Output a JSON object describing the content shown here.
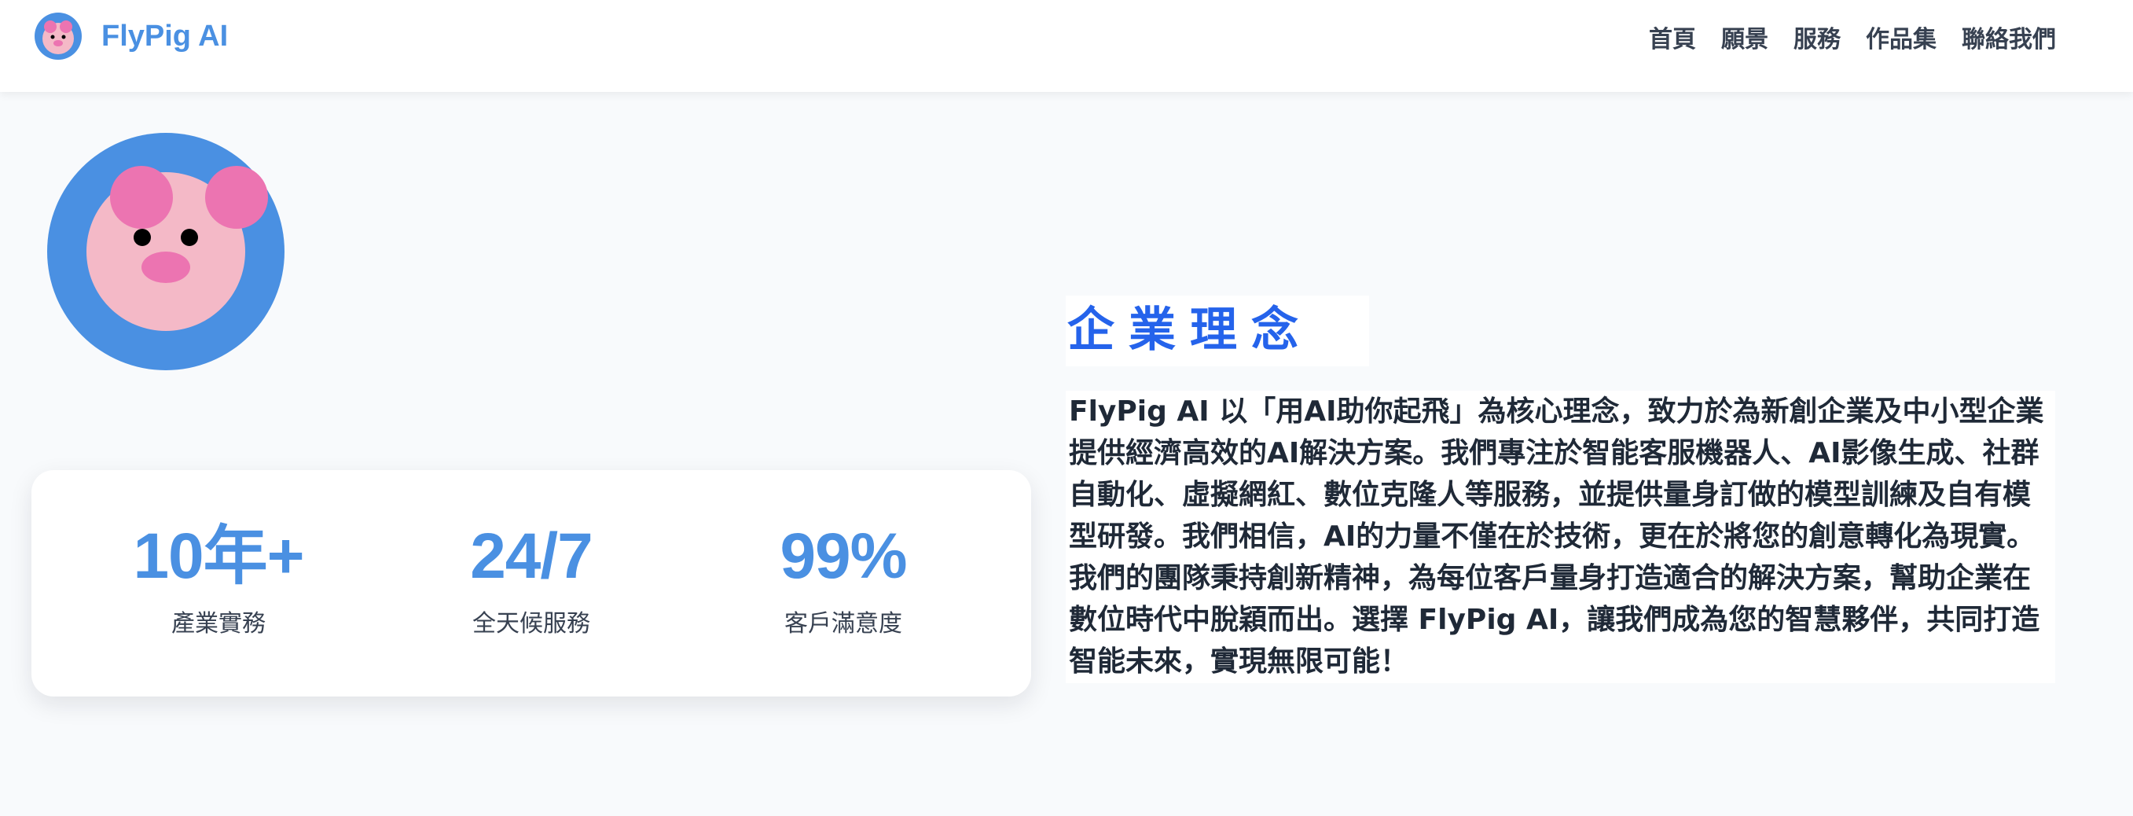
{
  "header": {
    "brand_name": "FlyPig AI",
    "nav": [
      {
        "label": "首頁"
      },
      {
        "label": "願景"
      },
      {
        "label": "服務"
      },
      {
        "label": "作品集"
      },
      {
        "label": "聯絡我們"
      }
    ]
  },
  "stats": [
    {
      "value": "10年+",
      "label": "產業實務"
    },
    {
      "value": "24/7",
      "label": "全天候服務"
    },
    {
      "value": "99%",
      "label": "客戶滿意度"
    }
  ],
  "philosophy": {
    "title": "企業理念",
    "body": "FlyPig AI 以「用AI助你起飛」為核心理念，致力於為新創企業及中小型企業提供經濟高效的AI解決方案。我們專注於智能客服機器人、AI影像生成、社群自動化、虛擬網紅、數位克隆人等服務，並提供量身訂做的模型訓練及自有模型研發。我們相信，AI的力量不僅在於技術，更在於將您的創意轉化為現實。我們的團隊秉持創新精神，為每位客戶量身打造適合的解決方案，幫助企業在數位時代中脫穎而出。選擇 FlyPig AI，讓我們成為您的智慧夥伴，共同打造智能未來，實現無限可能！"
  },
  "colors": {
    "brand": "#4a90e2",
    "title_accent": "#2563eb",
    "pig_face": "#f4b9c7",
    "pig_ears_snout": "#ec74b1",
    "background": "#f8fafc"
  }
}
